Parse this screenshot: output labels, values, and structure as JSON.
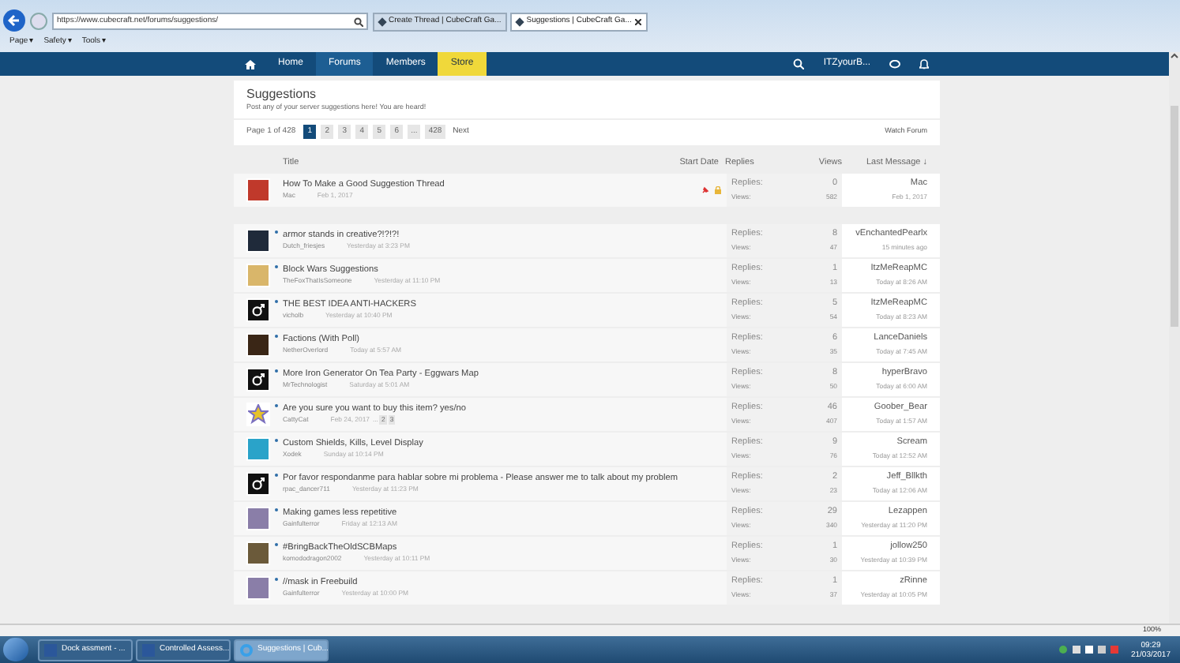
{
  "browser": {
    "url": "https://www.cubecraft.net/forums/suggestions/",
    "tabs": [
      {
        "title": "Create Thread | CubeCraft Ga...",
        "selected": false
      },
      {
        "title": "Suggestions | CubeCraft Ga...",
        "selected": true
      }
    ],
    "toolbar": [
      {
        "label": "Page",
        "caret": "▾"
      },
      {
        "label": "Safety",
        "caret": "▾"
      },
      {
        "label": "Tools",
        "caret": "▾"
      }
    ],
    "zoom": "100%"
  },
  "nav": {
    "items": [
      {
        "label": "Home",
        "selected": false,
        "highlight": false
      },
      {
        "label": "Forums",
        "selected": true,
        "highlight": false
      },
      {
        "label": "Members",
        "selected": false,
        "highlight": false
      },
      {
        "label": "Store",
        "selected": false,
        "highlight": true
      }
    ],
    "user": "ITZyourB..."
  },
  "forum": {
    "title": "Suggestions",
    "description": "Post any of your server suggestions here! You are heard!",
    "page_label": "Page 1 of 428",
    "pages": [
      {
        "label": "1",
        "selected": true
      },
      {
        "label": "2",
        "selected": false
      },
      {
        "label": "3",
        "selected": false
      },
      {
        "label": "4",
        "selected": false
      },
      {
        "label": "5",
        "selected": false
      },
      {
        "label": "6",
        "selected": false
      },
      {
        "label": "...",
        "selected": false
      },
      {
        "label": "428",
        "selected": false
      }
    ],
    "next": "Next",
    "watch": "Watch Forum"
  },
  "columns": {
    "title": "Title",
    "start_date": "Start Date",
    "replies": "Replies",
    "views": "Views",
    "last_message": "Last Message ↓"
  },
  "sticky": [
    {
      "title": "How To Make a Good Suggestion Thread",
      "author": "Mac",
      "date": "Feb 1, 2017",
      "pinned": true,
      "locked": true,
      "kind": "photo",
      "color": "#c0392b",
      "replies_label": "Replies:",
      "replies": "0",
      "views_label": "Views:",
      "views": "582",
      "last_user": "Mac",
      "last_time": "Feb 1, 2017"
    }
  ],
  "threads": [
    {
      "title": "armor stands in creative?!?!?!",
      "author": "Dutch_friesjes",
      "date": "Yesterday at 3:23 PM",
      "unread": true,
      "kind": "photo",
      "color": "#1f2a3a",
      "replies_label": "Replies:",
      "replies": "8",
      "views_label": "Views:",
      "views": "47",
      "last_user": "vEnchantedPearlx",
      "last_time": "15 minutes ago"
    },
    {
      "title": "Block Wars Suggestions",
      "author": "TheFoxThatIsSomeone",
      "date": "Yesterday at 11:10 PM",
      "unread": true,
      "kind": "photo",
      "color": "#d9b66a",
      "replies_label": "Replies:",
      "replies": "1",
      "views_label": "Views:",
      "views": "13",
      "last_user": "ItzMeReapMC",
      "last_time": "Today at 8:26 AM"
    },
    {
      "title": "THE BEST IDEA ANTI-HACKERS",
      "author": "vicholb",
      "date": "Yesterday at 10:40 PM",
      "unread": true,
      "kind": "male-symbol",
      "color": "#111111",
      "replies_label": "Replies:",
      "replies": "5",
      "views_label": "Views:",
      "views": "54",
      "last_user": "ItzMeReapMC",
      "last_time": "Today at 8:23 AM"
    },
    {
      "title": "Factions (With Poll)",
      "author": "NetherOverlord",
      "date": "Today at 5:57 AM",
      "unread": true,
      "kind": "photo",
      "color": "#3a2616",
      "replies_label": "Replies:",
      "replies": "6",
      "views_label": "Views:",
      "views": "35",
      "last_user": "LanceDaniels",
      "last_time": "Today at 7:45 AM"
    },
    {
      "title": "More Iron Generator On Tea Party - Eggwars Map",
      "author": "MrTechnologist",
      "date": "Saturday at 5:01 AM",
      "unread": true,
      "kind": "male-symbol",
      "color": "#111111",
      "replies_label": "Replies:",
      "replies": "8",
      "views_label": "Views:",
      "views": "50",
      "last_user": "hyperBravo",
      "last_time": "Today at 6:00 AM"
    },
    {
      "title": "Are you sure you want to buy this item? yes/no",
      "author": "CattyCat",
      "date": "Feb 24, 2017",
      "ellipsis": "...",
      "pages": [
        "2",
        "3"
      ],
      "unread": true,
      "kind": "star",
      "color": "#e6c229",
      "replies_label": "Replies:",
      "replies": "46",
      "views_label": "Views:",
      "views": "407",
      "last_user": "Goober_Bear",
      "last_time": "Today at 1:57 AM"
    },
    {
      "title": "Custom Shields, Kills, Level Display",
      "author": "Xodek",
      "date": "Sunday at 10:14 PM",
      "unread": true,
      "kind": "photo",
      "color": "#2aa3c9",
      "replies_label": "Replies:",
      "replies": "9",
      "views_label": "Views:",
      "views": "76",
      "last_user": "Scream",
      "last_time": "Today at 12:52 AM"
    },
    {
      "title": "Por favor respondanme para hablar sobre mi problema - Please answer me to talk about my problem",
      "author": "rpac_dancer711",
      "date": "Yesterday at 11:23 PM",
      "unread": true,
      "kind": "male-symbol",
      "color": "#111111",
      "replies_label": "Replies:",
      "replies": "2",
      "views_label": "Views:",
      "views": "23",
      "last_user": "Jeff_Bllkth",
      "last_time": "Today at 12:06 AM"
    },
    {
      "title": "Making games less repetitive",
      "author": "Gainfulterror",
      "date": "Friday at 12:13 AM",
      "unread": true,
      "kind": "photo",
      "color": "#8a7ea8",
      "replies_label": "Replies:",
      "replies": "29",
      "views_label": "Views:",
      "views": "340",
      "last_user": "Lezappen",
      "last_time": "Yesterday at 11:20 PM"
    },
    {
      "title": "#BringBackTheOldSCBMaps",
      "author": "komododragon2002",
      "date": "Yesterday at 10:11 PM",
      "unread": true,
      "kind": "photo",
      "color": "#6b5a3a",
      "replies_label": "Replies:",
      "replies": "1",
      "views_label": "Views:",
      "views": "30",
      "last_user": "jollow250",
      "last_time": "Yesterday at 10:39 PM"
    },
    {
      "title": "//mask in Freebuild",
      "author": "Gainfulterror",
      "date": "Yesterday at 10:00 PM",
      "unread": true,
      "kind": "photo",
      "color": "#8a7ea8",
      "replies_label": "Replies:",
      "replies": "1",
      "views_label": "Views:",
      "views": "37",
      "last_user": "zRinne",
      "last_time": "Yesterday at 10:05 PM"
    }
  ],
  "taskbar": [
    {
      "label": "Dock assment - ...",
      "kind": "word",
      "selected": false
    },
    {
      "label": "Controlled Assess...",
      "kind": "word",
      "selected": false
    },
    {
      "label": "Suggestions | Cub...",
      "kind": "ie",
      "selected": true
    }
  ],
  "clock": {
    "time": "09:29",
    "date": "21/03/2017"
  }
}
